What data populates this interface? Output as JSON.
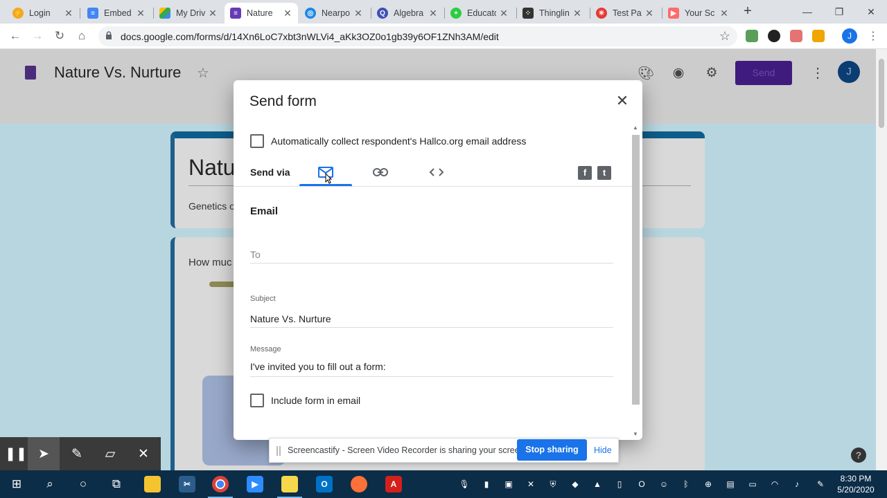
{
  "browser": {
    "tabs": [
      {
        "label": "Login",
        "icon": "login-favicon",
        "color": "#f5a623"
      },
      {
        "label": "Embed",
        "icon": "docs-favicon",
        "color": "#4285f4"
      },
      {
        "label": "My Driv",
        "icon": "drive-favicon",
        "color": "#34a853"
      },
      {
        "label": "Nature",
        "icon": "forms-favicon",
        "color": "#673ab7"
      },
      {
        "label": "Nearpo",
        "icon": "nearpod-favicon",
        "color": "#1e88e5"
      },
      {
        "label": "Algebra",
        "icon": "quizizz-favicon",
        "color": "#3f51b5"
      },
      {
        "label": "Educato",
        "icon": "edpuzzle-favicon",
        "color": "#2ecc40"
      },
      {
        "label": "Thinglin",
        "icon": "thinglink-favicon",
        "color": "#333333"
      },
      {
        "label": "Test Par",
        "icon": "testpark-favicon",
        "color": "#e53935"
      },
      {
        "label": "Your Sc",
        "icon": "screencastify-favicon",
        "color": "#ff6b6b"
      }
    ],
    "tab_close_glyph": "✕",
    "new_tab_glyph": "+",
    "url": "docs.google.com/forms/d/14Xn6LoC7xbt3nWLVi4_aKk3OZ0o1gb39y6OF1ZNh3AM/edit",
    "profile_initial": "J"
  },
  "forms": {
    "title": "Nature Vs. Nurture",
    "send_label": "Send",
    "avatar_initial": "J",
    "card_title_partial": "Natu",
    "card_sub_partial": "Genetics o",
    "question_partial": "How muc"
  },
  "dialog": {
    "title": "Send form",
    "collect_email_label": "Automatically collect respondent's Hallco.org email address",
    "send_via_label": "Send via",
    "send_via_options": [
      "email-icon",
      "link-icon",
      "embed-icon"
    ],
    "active_option": "email",
    "email_section_title": "Email",
    "to_placeholder": "To",
    "subject_label": "Subject",
    "subject_value": "Nature Vs. Nurture",
    "message_label": "Message",
    "message_value": "I've invited you to fill out a form:",
    "include_form_label": "Include form in email"
  },
  "screencastify": {
    "message": "Screencastify - Screen Video Recorder is sharing your screen.",
    "stop_label": "Stop sharing",
    "hide_label": "Hide"
  },
  "taskbar": {
    "time": "8:30 PM",
    "date": "5/20/2020"
  },
  "colors": {
    "accent": "#1a73e8",
    "forms_purple": "#673ab7"
  }
}
